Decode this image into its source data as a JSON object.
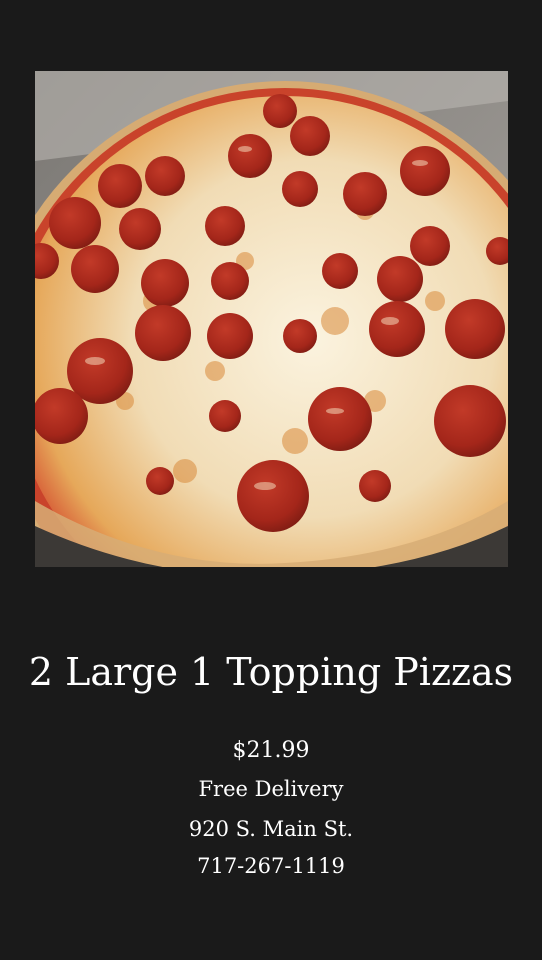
{
  "promo": {
    "headline": "2 Large 1 Topping Pizzas",
    "price": "$21.99",
    "delivery": "Free Delivery",
    "address": "920 S. Main St.",
    "phone": "717-267-1119"
  },
  "photo": {
    "subject": "pepperoni-pizza"
  },
  "colors": {
    "background": "#1a1a1a",
    "text": "#ffffff",
    "cheese": "#f3e3c2",
    "sauce": "#c8321f",
    "pepperoni": "#a8281b",
    "crust": "#d9b27c",
    "box": "#8c8782"
  }
}
